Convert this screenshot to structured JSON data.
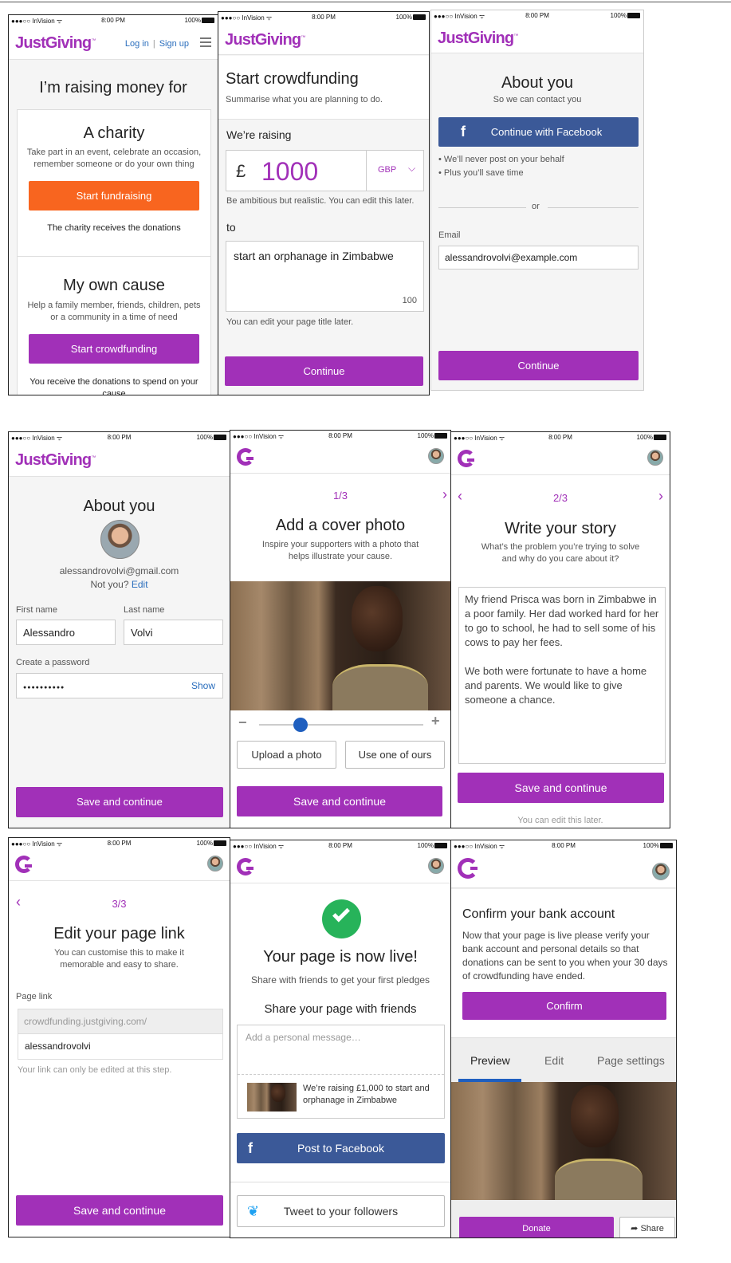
{
  "status": {
    "carrier": "●●●○○ InVision ᯤ",
    "time": "8:00 PM",
    "battery": "100%"
  },
  "brand": {
    "logo": "JustGiving",
    "logo_mark": "™",
    "accent": "#a130b8",
    "orange": "#f8651f",
    "facebook": "#3b5998"
  },
  "s1": {
    "login": "Log in",
    "signup": "Sign up",
    "title": "I’m raising money for",
    "charity": {
      "title": "A charity",
      "desc": "Take part in an event, celebrate an occasion, remember someone or do your own thing",
      "button": "Start fundraising",
      "note": "The charity receives the donations"
    },
    "own": {
      "title": "My own cause",
      "desc": "Help a family member, friends, children, pets or a community in a time of need",
      "button": "Start crowdfunding",
      "note": "You receive the donations to spend on your cause"
    }
  },
  "s2": {
    "title": "Start crowdfunding",
    "subtitle": "Summarise what you are planning to do.",
    "raising_label": "We’re raising",
    "currency_symbol": "£",
    "amount": "1000",
    "currency": "GBP",
    "amount_hint": "Be ambitious but realistic. You can edit this later.",
    "to_label": "to",
    "purpose": "start an orphanage in Zimbabwe",
    "char_count": "100",
    "purpose_hint": "You can edit your page title later.",
    "button": "Continue"
  },
  "s3": {
    "title": "About you",
    "subtitle": "So we can contact you",
    "facebook_button": "Continue with Facebook",
    "bullets": [
      "• We’ll never post on your behalf",
      "• Plus you’ll save time"
    ],
    "or": "or",
    "email_label": "Email",
    "email": "alessandrovolvi@example.com",
    "button": "Continue"
  },
  "s4": {
    "title": "About you",
    "email": "alessandrovolvi@gmail.com",
    "not_you": "Not you?",
    "edit": "Edit",
    "first_label": "First name",
    "first": "Alessandro",
    "last_label": "Last name",
    "last": "Volvi",
    "password_label": "Create a password",
    "password": "●●●●●●●●●●",
    "show": "Show",
    "button": "Save and continue"
  },
  "s5": {
    "step": "1/3",
    "title": "Add a cover photo",
    "subtitle": "Inspire your supporters with a photo that helps illustrate your cause.",
    "zoom_out": "−",
    "zoom_in": "+",
    "zoom_level": 0.25,
    "upload": "Upload a photo",
    "use_ours": "Use one of ours",
    "button": "Save and continue"
  },
  "s6": {
    "step": "2/3",
    "title": "Write your story",
    "subtitle": "What’s the problem you’re trying to solve and why do you care about it?",
    "story_p1": "My friend Prisca was born in Zimbabwe in a poor family. Her dad worked hard for her to go to school, he had to sell some of his cows to pay her fees.",
    "story_p2": "We both were fortunate to have a home and parents. We would like to give someone a chance.",
    "button": "Save and continue",
    "note": "You can edit this later."
  },
  "s7": {
    "step": "3/3",
    "title": "Edit your page link",
    "subtitle": "You can customise this to make it memorable and easy to share.",
    "link_label": "Page link",
    "prefix": "crowdfunding.justgiving.com/",
    "slug": "alessandrovolvi",
    "hint": "Your link can only be edited at this step.",
    "button": "Save and continue"
  },
  "s8": {
    "title": "Your page is now live!",
    "subtitle": "Share with friends to get your first pledges",
    "share_heading": "Share your page with friends",
    "message_placeholder": "Add a personal message…",
    "preview_text": "We’re raising £1,000 to start and orphanage in Zimbabwe",
    "facebook_button": "Post to Facebook",
    "twitter_button": "Tweet to your followers"
  },
  "s9": {
    "title": "Confirm your bank account",
    "desc": "Now that your page is live please verify your bank account and personal details so that donations can be sent to you when your 30 days of crowdfunding have ended.",
    "button": "Confirm",
    "tabs": [
      "Preview",
      "Edit",
      "Page settings"
    ],
    "donate": "Donate",
    "share": "Share"
  }
}
